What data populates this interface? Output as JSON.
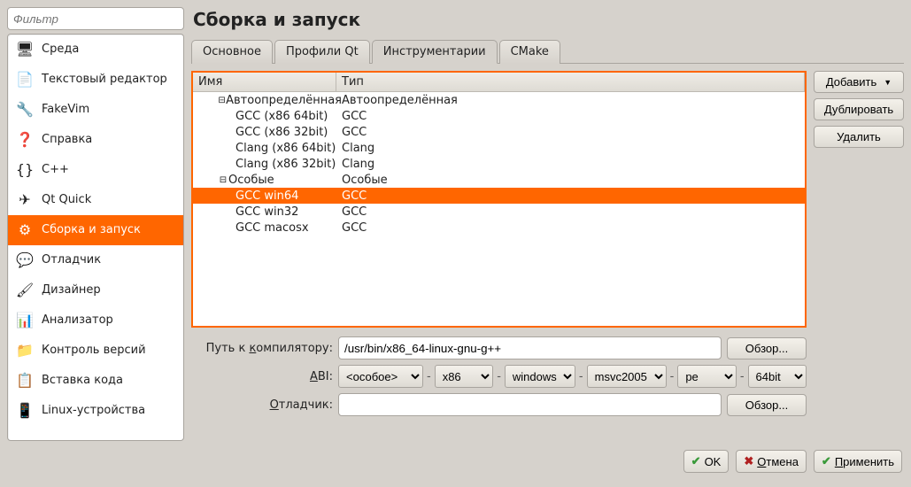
{
  "filter_placeholder": "Фильтр",
  "page_title": "Сборка и запуск",
  "sidebar": {
    "items": [
      {
        "label": "Среда",
        "icon": "🖥"
      },
      {
        "label": "Текстовый редактор",
        "icon": "📄"
      },
      {
        "label": "FakeVim",
        "icon": "🔧"
      },
      {
        "label": "Справка",
        "icon": "❓"
      },
      {
        "label": "C++",
        "icon": "{}"
      },
      {
        "label": "Qt Quick",
        "icon": "✈"
      },
      {
        "label": "Сборка и запуск",
        "icon": "⚙"
      },
      {
        "label": "Отладчик",
        "icon": "💬"
      },
      {
        "label": "Дизайнер",
        "icon": "🖌"
      },
      {
        "label": "Анализатор",
        "icon": "📊"
      },
      {
        "label": "Контроль версий",
        "icon": "📁"
      },
      {
        "label": "Вставка кода",
        "icon": "📋"
      },
      {
        "label": "Linux-устройства",
        "icon": "📱"
      }
    ],
    "selected_index": 6
  },
  "tabs": {
    "items": [
      "Основное",
      "Профили Qt",
      "Инструментарии",
      "CMake"
    ],
    "active_index": 2
  },
  "tree": {
    "headers": {
      "name": "Имя",
      "type": "Тип"
    },
    "groups": [
      {
        "label": "Автоопределённая",
        "type": "Автоопределённая",
        "children": [
          {
            "name": "GCC (x86 64bit)",
            "type": "GCC"
          },
          {
            "name": "GCC (x86 32bit)",
            "type": "GCC"
          },
          {
            "name": "Clang (x86 64bit)",
            "type": "Clang"
          },
          {
            "name": "Clang (x86 32bit)",
            "type": "Clang"
          }
        ]
      },
      {
        "label": "Особые",
        "type": "Особые",
        "children": [
          {
            "name": "GCC win64",
            "type": "GCC",
            "selected": true
          },
          {
            "name": "GCC win32",
            "type": "GCC"
          },
          {
            "name": "GCC macosx",
            "type": "GCC"
          }
        ]
      }
    ]
  },
  "side_buttons": {
    "add": "Добавить",
    "clone": "Дублировать",
    "remove": "Удалить"
  },
  "form": {
    "compiler_label": "Путь к компилятору:",
    "compiler_path": "/usr/bin/x86_64-linux-gnu-g++",
    "abi_label": "ABI:",
    "abi_values": [
      "<особое>",
      "x86",
      "windows",
      "msvc2005",
      "pe",
      "64bit"
    ],
    "debugger_label": "Отладчик:",
    "debugger_path": "",
    "browse": "Обзор..."
  },
  "dialog": {
    "ok": "OK",
    "cancel": "Отмена",
    "apply": "Применить"
  }
}
